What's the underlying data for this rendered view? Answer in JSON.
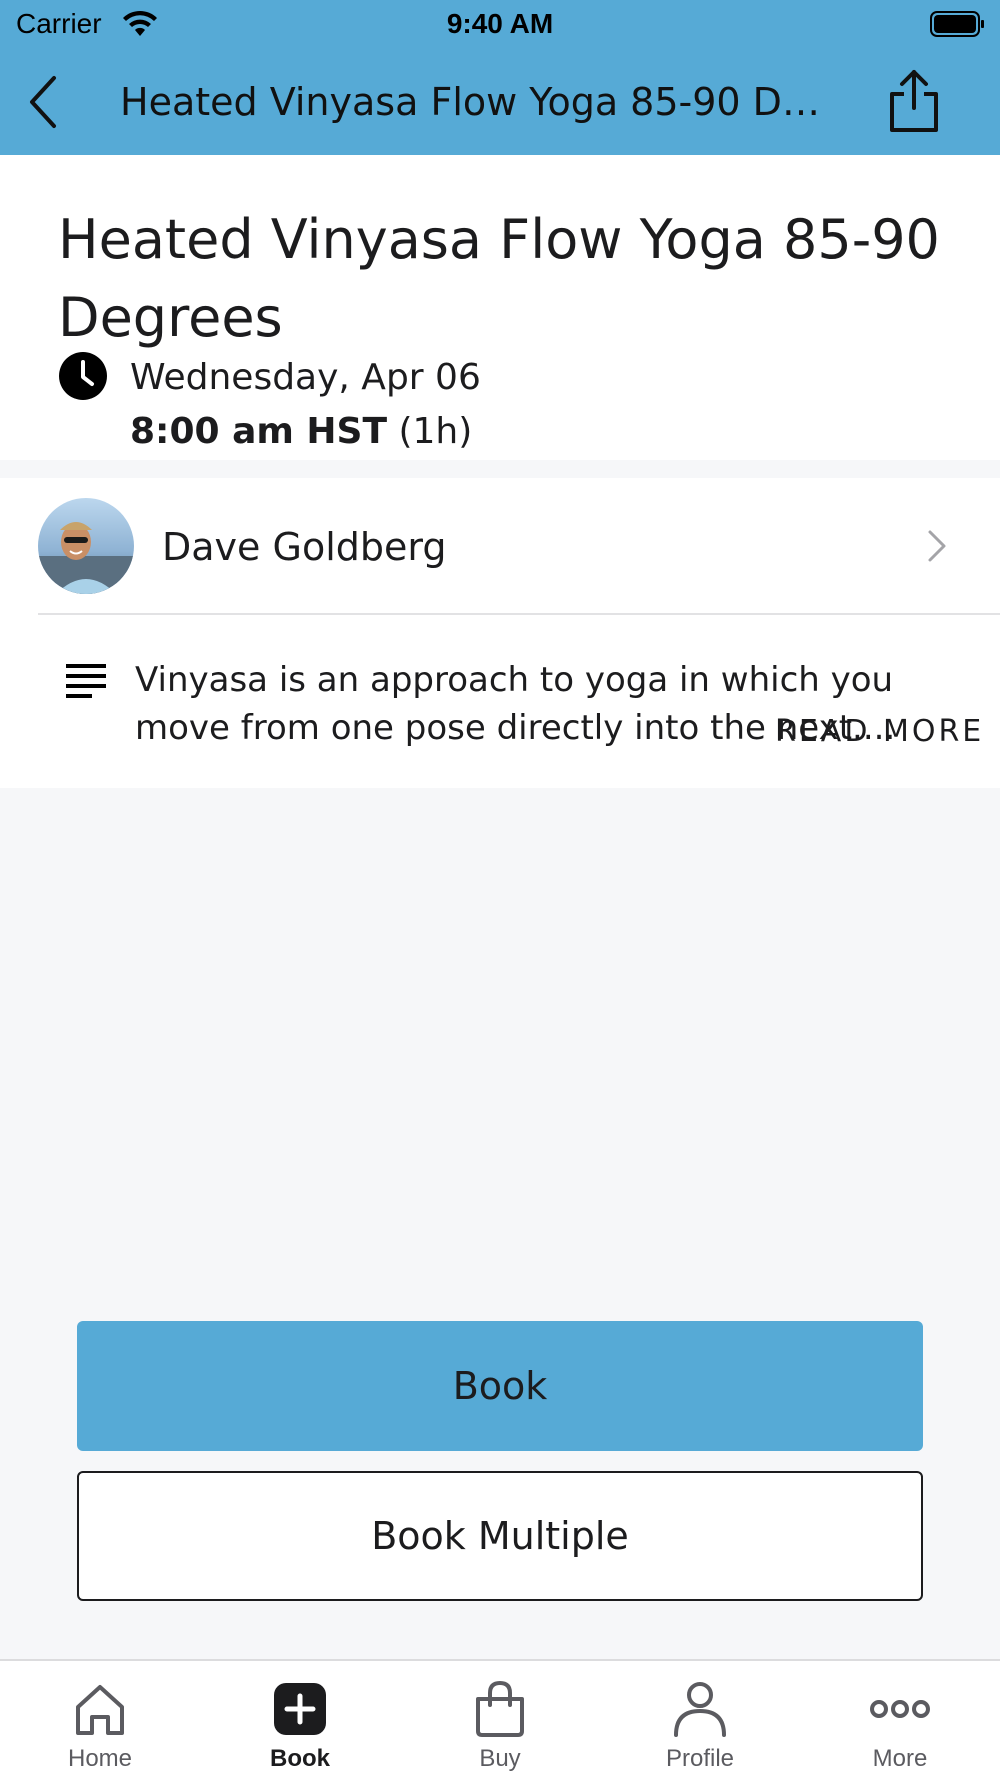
{
  "status_bar": {
    "carrier": "Carrier",
    "time": "9:40 AM"
  },
  "nav": {
    "title": "Heated Vinyasa Flow Yoga 85-90 Degrees",
    "back_icon": "chevron-left-icon",
    "share_icon": "share-icon"
  },
  "class": {
    "title": "Heated Vinyasa Flow Yoga 85-90 Degrees",
    "date": "Wednesday, Apr 06",
    "time": "8:00 am HST",
    "duration": "(1h)"
  },
  "instructor": {
    "name": "Dave Goldberg"
  },
  "description": {
    "text": "Vinyasa is an approach to yoga in which you move from one pose directly into the next....",
    "read_more": "READ MORE"
  },
  "actions": {
    "book_label": "Book",
    "book_multiple_label": "Book Multiple"
  },
  "tab_bar": {
    "items": [
      {
        "label": "Home",
        "icon": "home-icon"
      },
      {
        "label": "Book",
        "icon": "plus-square-icon",
        "active": true
      },
      {
        "label": "Buy",
        "icon": "shopping-bag-icon"
      },
      {
        "label": "Profile",
        "icon": "person-icon"
      },
      {
        "label": "More",
        "icon": "more-dots-icon"
      }
    ]
  },
  "colors": {
    "accent": "#56aad6",
    "background": "#f6f7f9"
  }
}
